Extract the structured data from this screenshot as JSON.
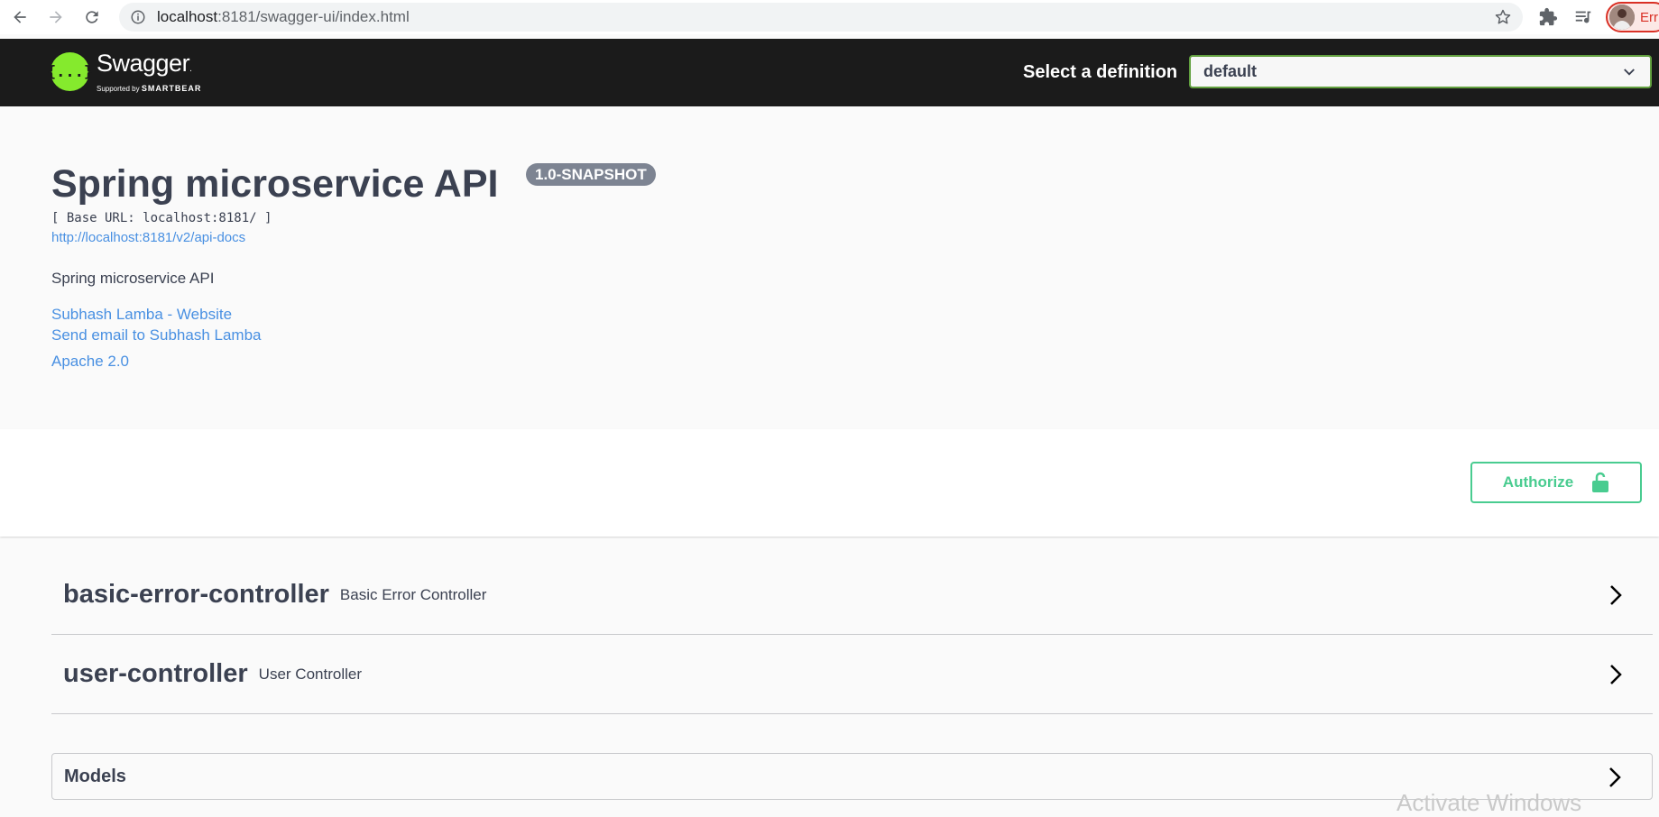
{
  "browser": {
    "url_host": "localhost",
    "url_path": ":8181/swagger-ui/index.html",
    "profile_label": "Err"
  },
  "topbar": {
    "brand": "Swagger",
    "brand_tm": ".",
    "supported_by": "Supported by",
    "smartbear": "SMARTBEAR",
    "logo_glyph": "{...}",
    "definition_label": "Select a definition",
    "definition_value": "default"
  },
  "info": {
    "title": "Spring microservice API",
    "version": "1.0-SNAPSHOT",
    "base_url": "[ Base URL: localhost:8181/ ]",
    "docs_url": "http://localhost:8181/v2/api-docs",
    "description": "Spring microservice API",
    "contact_website": "Subhash Lamba - Website",
    "contact_email": "Send email to Subhash Lamba",
    "license": "Apache 2.0"
  },
  "scheme": {
    "authorize_label": "Authorize"
  },
  "tags": [
    {
      "name": "basic-error-controller",
      "description": "Basic Error Controller"
    },
    {
      "name": "user-controller",
      "description": "User Controller"
    }
  ],
  "models": {
    "title": "Models"
  },
  "watermark": "Activate Windows",
  "colors": {
    "topbar_bg": "#1b1b1b",
    "swagger_green": "#85ea2d",
    "authorize_green": "#49cc90",
    "link_blue": "#4990e2",
    "version_badge": "#7d8492",
    "text": "#3b4151"
  }
}
